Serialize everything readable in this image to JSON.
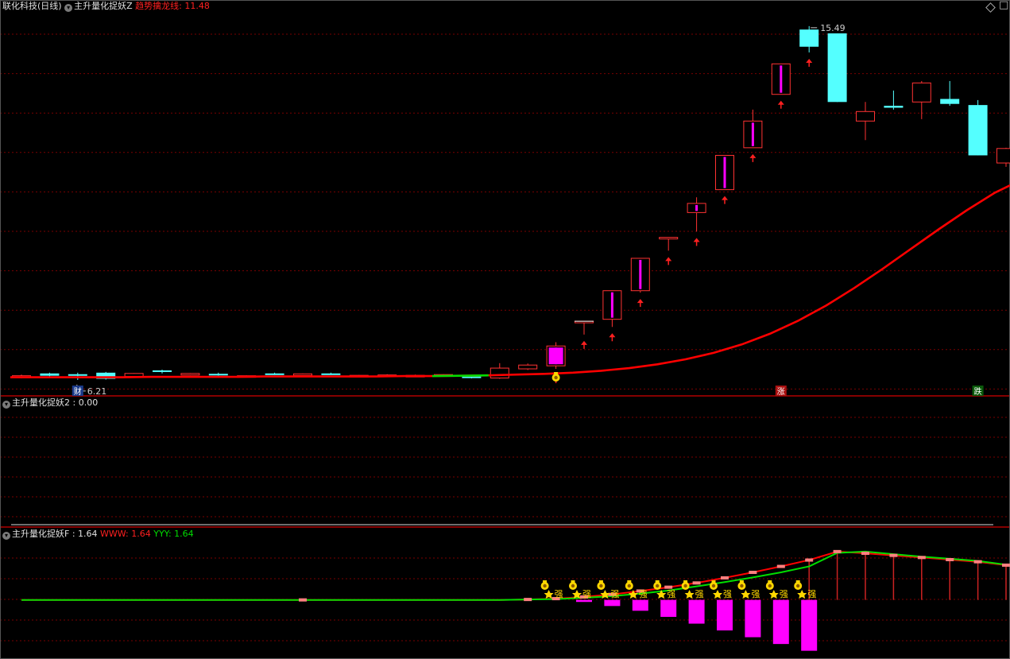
{
  "header": {
    "stock_name": "联化科技(日线)",
    "indicator_main": "主升量化捉妖Z",
    "trend_label": "趋势擒龙线",
    "trend_value": "11.48"
  },
  "panel2": {
    "label": "主升量化捉妖2",
    "value": "0.00"
  },
  "panel3": {
    "label": "主升量化捉妖F",
    "value": "1.64",
    "www_label": "WWW",
    "www_value": "1.64",
    "yyy_label": "YYY",
    "yyy_value": "1.64"
  },
  "markers": {
    "cai": "财",
    "zhang": "涨",
    "die": "跌",
    "qiang": "强"
  },
  "colors": {
    "up": "#ff3232",
    "down": "#54ffff",
    "ma": "#ff0000",
    "green": "#00dd00",
    "magenta": "#ff00ff",
    "grid": "#7a0000",
    "divider": "#b00000",
    "bag": "#ffd700"
  },
  "chart_data": {
    "type": "candlestick",
    "price_annotations": {
      "high_label": "15.49",
      "low_label": "6.21"
    },
    "candles": [
      {
        "o": 6.3,
        "h": 6.35,
        "l": 6.25,
        "c": 6.32
      },
      {
        "o": 6.38,
        "h": 6.4,
        "l": 6.3,
        "c": 6.32
      },
      {
        "o": 6.36,
        "h": 6.4,
        "l": 6.21,
        "c": 6.34
      },
      {
        "o": 6.4,
        "h": 6.42,
        "l": 6.22,
        "c": 6.24
      },
      {
        "o": 6.3,
        "h": 6.39,
        "l": 6.28,
        "c": 6.38
      },
      {
        "o": 6.46,
        "h": 6.48,
        "l": 6.38,
        "c": 6.42
      },
      {
        "o": 6.36,
        "h": 6.39,
        "l": 6.33,
        "c": 6.38
      },
      {
        "o": 6.37,
        "h": 6.4,
        "l": 6.32,
        "c": 6.35
      },
      {
        "o": 6.3,
        "h": 6.33,
        "l": 6.28,
        "c": 6.32
      },
      {
        "o": 6.38,
        "h": 6.4,
        "l": 6.34,
        "c": 6.36
      },
      {
        "o": 6.34,
        "h": 6.38,
        "l": 6.32,
        "c": 6.37
      },
      {
        "o": 6.38,
        "h": 6.4,
        "l": 6.34,
        "c": 6.35
      },
      {
        "o": 6.32,
        "h": 6.34,
        "l": 6.3,
        "c": 6.33
      },
      {
        "o": 6.33,
        "h": 6.36,
        "l": 6.3,
        "c": 6.34
      },
      {
        "o": 6.32,
        "h": 6.35,
        "l": 6.3,
        "c": 6.33
      },
      {
        "o": 6.34,
        "h": 6.36,
        "l": 6.32,
        "c": 6.35
      },
      {
        "o": 6.3,
        "h": 6.34,
        "l": 6.25,
        "c": 6.26
      },
      {
        "o": 6.26,
        "h": 6.65,
        "l": 6.24,
        "c": 6.52
      },
      {
        "o": 6.5,
        "h": 6.64,
        "l": 6.47,
        "c": 6.6
      },
      {
        "o": 6.58,
        "h": 7.2,
        "l": 6.5,
        "c": 7.1
      },
      {
        "o": 7.75,
        "h": 7.75,
        "l": 7.4,
        "c": 7.75
      },
      {
        "o": 7.8,
        "h": 8.55,
        "l": 7.6,
        "c": 8.55
      },
      {
        "o": 8.55,
        "h": 9.4,
        "l": 8.5,
        "c": 9.4
      },
      {
        "o": 9.95,
        "h": 9.95,
        "l": 9.6,
        "c": 9.95
      },
      {
        "o": 10.6,
        "h": 11.0,
        "l": 10.1,
        "c": 10.84
      },
      {
        "o": 11.2,
        "h": 12.1,
        "l": 11.2,
        "c": 12.1
      },
      {
        "o": 12.3,
        "h": 13.3,
        "l": 12.3,
        "c": 13.0
      },
      {
        "o": 13.7,
        "h": 14.5,
        "l": 13.7,
        "c": 14.5
      },
      {
        "o": 15.4,
        "h": 15.49,
        "l": 14.8,
        "c": 14.95
      },
      {
        "o": 15.3,
        "h": 15.3,
        "l": 13.5,
        "c": 13.5
      },
      {
        "o": 13.0,
        "h": 13.5,
        "l": 12.5,
        "c": 13.25
      },
      {
        "o": 13.4,
        "h": 13.8,
        "l": 13.3,
        "c": 13.35
      },
      {
        "o": 13.5,
        "h": 14.05,
        "l": 13.05,
        "c": 14.0
      },
      {
        "o": 13.58,
        "h": 14.05,
        "l": 13.4,
        "c": 13.45
      },
      {
        "o": 13.42,
        "h": 13.55,
        "l": 12.1,
        "c": 12.1
      },
      {
        "o": 11.9,
        "h": 12.3,
        "l": 11.8,
        "c": 12.28
      }
    ],
    "trend_line": [
      6.28,
      6.28,
      6.28,
      6.28,
      6.28,
      6.29,
      6.29,
      6.29,
      6.29,
      6.3,
      6.3,
      6.3,
      6.3,
      6.3,
      6.31,
      6.31,
      6.32,
      6.33,
      6.35,
      6.37,
      6.4,
      6.45,
      6.52,
      6.62,
      6.75,
      6.92,
      7.14,
      7.42,
      7.76,
      8.16,
      8.62,
      9.12,
      9.64,
      10.16,
      10.66,
      11.12,
      11.48
    ],
    "trend_line_green_segments": [
      [
        15,
        17
      ]
    ],
    "up_arrows": [
      19,
      20,
      21,
      22,
      23,
      24,
      25,
      26,
      27,
      28
    ],
    "bag_main": [
      19
    ],
    "cai_index": 2,
    "zhang_index": 27,
    "die_index": 34,
    "f_www": [
      0.5,
      0.5,
      0.5,
      0.5,
      0.5,
      0.5,
      0.5,
      0.5,
      0.5,
      0.5,
      0.5,
      0.5,
      0.5,
      0.5,
      0.5,
      0.5,
      0.5,
      0.5,
      0.51,
      0.53,
      0.57,
      0.63,
      0.71,
      0.8,
      0.9,
      1.02,
      1.15,
      1.29,
      1.44,
      1.64,
      1.6,
      1.55,
      1.5,
      1.45,
      1.4,
      1.32,
      1.22
    ],
    "f_yyy": [
      0.5,
      0.5,
      0.5,
      0.5,
      0.5,
      0.5,
      0.5,
      0.5,
      0.5,
      0.5,
      0.5,
      0.5,
      0.5,
      0.5,
      0.5,
      0.5,
      0.5,
      0.5,
      0.51,
      0.52,
      0.55,
      0.59,
      0.65,
      0.72,
      0.82,
      0.92,
      1.03,
      1.15,
      1.29,
      1.61,
      1.64,
      1.58,
      1.52,
      1.47,
      1.42,
      1.33,
      1.23
    ],
    "f_stem_from": 28,
    "f_neg_bars": [
      [
        20,
        -0.03
      ],
      [
        21,
        -0.09
      ],
      [
        22,
        -0.16
      ],
      [
        23,
        -0.25
      ],
      [
        24,
        -0.35
      ],
      [
        25,
        -0.45
      ],
      [
        26,
        -0.55
      ],
      [
        27,
        -0.65
      ],
      [
        28,
        -0.75
      ]
    ],
    "f_signals": [
      19,
      20,
      21,
      22,
      23,
      24,
      25,
      26,
      27,
      28
    ],
    "price_range": [
      6.0,
      15.8
    ],
    "f_range": [
      -0.8,
      1.9
    ]
  }
}
